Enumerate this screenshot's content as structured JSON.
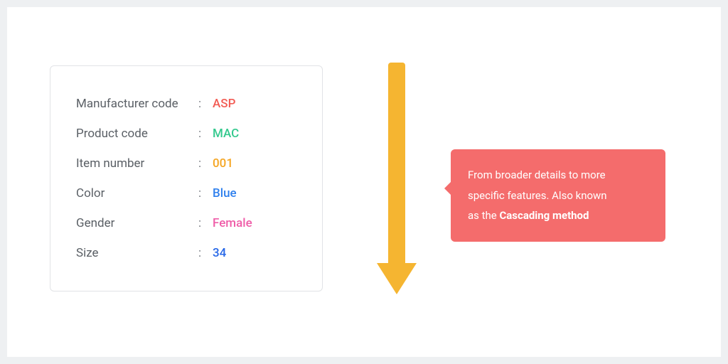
{
  "attributes": [
    {
      "label": "Manufacturer code",
      "value": "ASP",
      "color_class": "c-red"
    },
    {
      "label": "Product code",
      "value": "MAC",
      "color_class": "c-green"
    },
    {
      "label": "Item number",
      "value": "001",
      "color_class": "c-orange"
    },
    {
      "label": "Color",
      "value": "Blue",
      "color_class": "c-blue1"
    },
    {
      "label": "Gender",
      "value": "Female",
      "color_class": "c-pink"
    },
    {
      "label": "Size",
      "value": "34",
      "color_class": "c-blue2"
    }
  ],
  "callout": {
    "line1": "From broader details to more",
    "line2": "specific features. Also known",
    "line3_pre": "as the ",
    "line3_bold": "Cascading method"
  },
  "colors": {
    "arrow": "#f5b531",
    "callout_bg": "#f46c6c"
  }
}
